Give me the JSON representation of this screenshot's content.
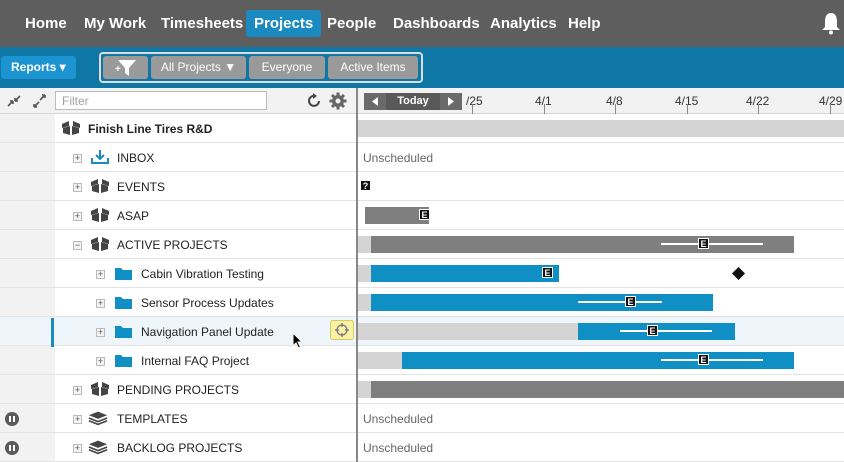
{
  "nav": {
    "items": [
      {
        "label": "Home"
      },
      {
        "label": "My Work"
      },
      {
        "label": "Timesheets"
      },
      {
        "label": "Projects"
      },
      {
        "label": "People"
      },
      {
        "label": "Dashboards"
      },
      {
        "label": "Analytics"
      },
      {
        "label": "Help"
      }
    ],
    "active": "Projects",
    "bell_icon": "bell-icon"
  },
  "toolbar": {
    "reports_label": "Reports ▾",
    "filter_icon": "add-filter-icon",
    "all_projects_label": "All Projects ▼",
    "everyone_label": "Everyone",
    "active_items_label": "Active Items"
  },
  "left_header": {
    "collapse_icon": "collapse-all-icon",
    "expand_icon": "expand-all-icon",
    "filter_placeholder": "Filter",
    "refresh_icon": "refresh-icon",
    "settings_icon": "gear-icon"
  },
  "timeline": {
    "today_label": "Today",
    "dates": [
      "/25",
      "4/1",
      "4/8",
      "4/15",
      "4/22",
      "4/29"
    ]
  },
  "rows": [
    {
      "label": "Finish Line Tires R&D",
      "icon": "package-icon"
    },
    {
      "label": "INBOX",
      "icon": "inbox-icon",
      "status": "Unscheduled"
    },
    {
      "label": "EVENTS",
      "icon": "package-icon"
    },
    {
      "label": "ASAP",
      "icon": "package-icon"
    },
    {
      "label": "ACTIVE PROJECTS",
      "icon": "package-icon"
    },
    {
      "label": "Cabin Vibration Testing",
      "icon": "folder-icon"
    },
    {
      "label": "Sensor Process Updates",
      "icon": "folder-icon"
    },
    {
      "label": "Navigation Panel Update",
      "icon": "folder-icon"
    },
    {
      "label": "Internal FAQ Project",
      "icon": "folder-icon"
    },
    {
      "label": "PENDING PROJECTS",
      "icon": "package-icon"
    },
    {
      "label": "TEMPLATES",
      "icon": "layers-icon",
      "status": "Unscheduled"
    },
    {
      "label": "BACKLOG PROJECTS",
      "icon": "layers-icon",
      "status": "Unscheduled"
    }
  ],
  "colors": {
    "nav_bg": "#5e5e5e",
    "nav_active": "#1a8ac0",
    "toolbar_bg": "#0e77a6",
    "bar_blue": "#0f8fc4",
    "bar_gray": "#7f7f7f"
  }
}
